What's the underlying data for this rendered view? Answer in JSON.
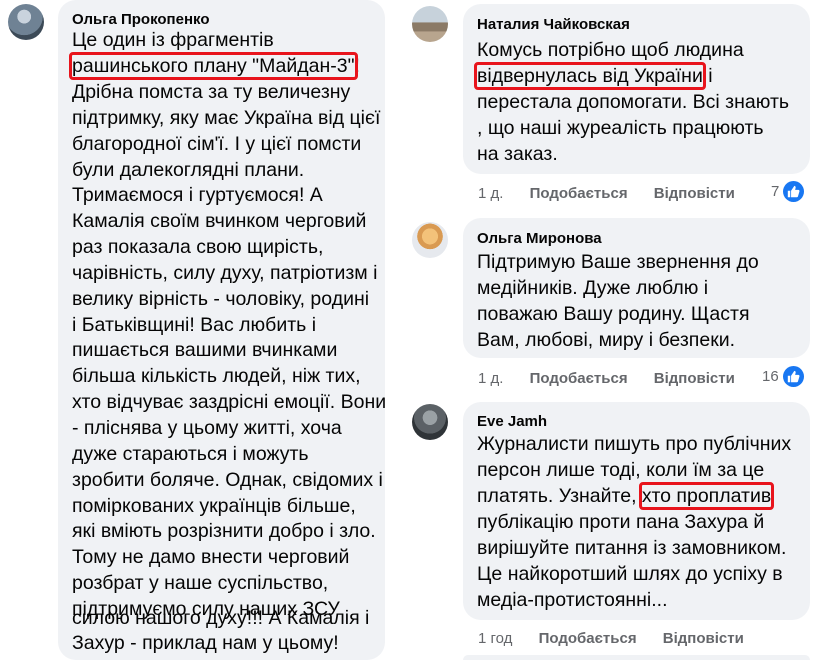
{
  "comments": [
    {
      "author": "Ольга Прокопенко",
      "lines": [
        "Це один із фрагментів",
        "рашинського плану \"Майдан-3\"!",
        "Дрібна помста за ту величезну",
        "підтримку, яку має Україна від цієї",
        "благородної сім'ї. І у цієї помсти",
        "були далекоглядні плани.",
        "Тримаємося і гуртуємося! А",
        "Камалія своїм вчинком черговий",
        "раз показала свою щирість,",
        "чарівність, силу духу, патріотизм і",
        "велику вірність - чоловіку, родині",
        "і Батьківщині! Вас любить і",
        "пишається вашими вчинками",
        "більша кількість людей, ніж тих,",
        "хто відчуває заздрісні емоції. Вони",
        "- плiснява у цьому житті, хоча",
        "дуже стараються і можуть",
        "зробити боляче. Однак, свідомих і",
        "поміркованих українців більше,",
        "які вміють розрізнити добро і зло.",
        "Тому не дамо внести черговий",
        "розбрат у наше суспільство,",
        "підтримуємо силу наших ЗСУ",
        "силою нашого духу!!! А Камалія і",
        "Захур - приклад нам у цьому!"
      ]
    },
    {
      "author": "Наталия Чайковская",
      "line1": "Комусь потрібно щоб людина",
      "line2_hl": "відвернулась від України",
      "line2_rest": "і",
      "line3": "перестала допомогати. Всі знають",
      "line4": ", що наші журеалість працюють",
      "line5": "на заказ.",
      "time": "1 д.",
      "like": "Подобається",
      "reply": "Відповісти",
      "reactions": "7"
    },
    {
      "author": "Ольга Миронова",
      "line1": "Підтримую Ваше звернення до",
      "line2": "медійників. Дуже люблю і",
      "line3": "поважаю Вашу родину. Щастя",
      "line4": "Вам, любові, миру і безпеки.",
      "time": "1 д.",
      "like": "Подобається",
      "reply": "Відповісти",
      "reactions": "16"
    },
    {
      "author": "Eve Jamh",
      "line1": "Журналисти пишуть про публічних",
      "line2": "персон лише тоді, коли їм за це",
      "line3_pre": "платять. Узнайте,",
      "line3_hl": "хто проплатив",
      "line4": "публікацію проти пана Захура й",
      "line5": "вирішуйте питання із замовником.",
      "line6": "Це найкоротший шлях до успіху в",
      "line7": "медіа-протистоянні...",
      "time": "1 год",
      "like": "Подобається",
      "reply": "Відповісти"
    }
  ],
  "first_highlight": {
    "before": "рашинського плану \"Майдан-3\"",
    "after": "!"
  },
  "colors": {
    "bubble": "#f0f2f5",
    "highlight": "#e8141c",
    "like": "#1877f2",
    "meta": "#65676b"
  },
  "icons": [
    "like-icon"
  ]
}
